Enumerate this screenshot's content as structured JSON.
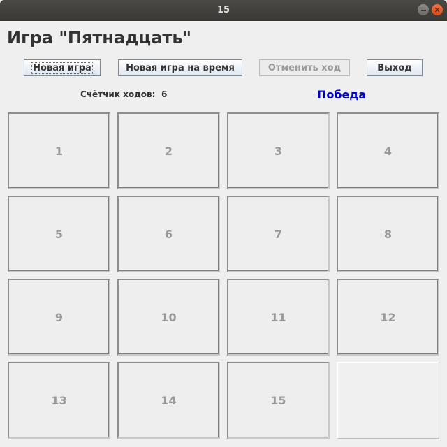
{
  "window": {
    "title": "15"
  },
  "heading": "Игра \"Пятнадцать\"",
  "toolbar": {
    "new_game": "Новая игра",
    "new_timed_game": "Новая игра на время",
    "undo": "Отменить ход",
    "exit": "Выход"
  },
  "counter": {
    "label": "Счётчик ходов:",
    "value": "6"
  },
  "status": "Победа",
  "board": {
    "tiles": [
      "1",
      "2",
      "3",
      "4",
      "5",
      "6",
      "7",
      "8",
      "9",
      "10",
      "11",
      "12",
      "13",
      "14",
      "15",
      ""
    ]
  }
}
